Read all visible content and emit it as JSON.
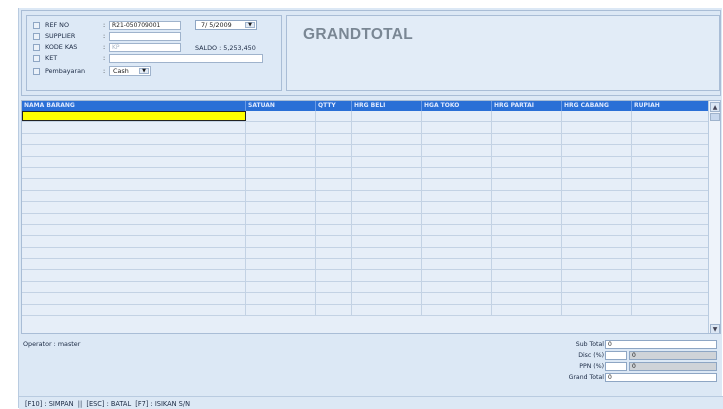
{
  "form": {
    "ref_no": {
      "label": "REF NO",
      "value": "R21-050709001"
    },
    "date": {
      "value": "7/ 5/2009"
    },
    "supplier": {
      "label": "SUPPLIER",
      "value": ""
    },
    "kode_kas": {
      "label": "KODE KAS",
      "value": "KP"
    },
    "saldo": "SALDO : 5,253,450",
    "ket": {
      "label": "KET",
      "value": ""
    },
    "pembayaran": {
      "label": "Pembayaran",
      "value": "Cash"
    },
    "colon": ":"
  },
  "grandtotal_title": "GRANDTOTAL",
  "grid": {
    "columns": [
      "NAMA BARANG",
      "SATUAN",
      "QTTY",
      "HRG BELI",
      "HGA TOKO",
      "HRG PARTAI",
      "HRG CABANG",
      "RUPIAH"
    ],
    "row_count": 18
  },
  "footer": {
    "operator": "Operator : master",
    "sub_total": {
      "label": "Sub Total",
      "value": "0"
    },
    "disc": {
      "label": "Disc (%)",
      "value": "",
      "amount": "0"
    },
    "ppn": {
      "label": "PPN (%)",
      "value": "",
      "amount": "0"
    },
    "grand_total": {
      "label": "Grand Total",
      "value": "0"
    }
  },
  "status_bar": "[F10] : SIMPAN  ||  [ESC] : BATAL  [F7] : ISIKAN S/N",
  "icons": {
    "scroll_up": "▲",
    "scroll_down": "▼",
    "dropdown": "▼"
  }
}
